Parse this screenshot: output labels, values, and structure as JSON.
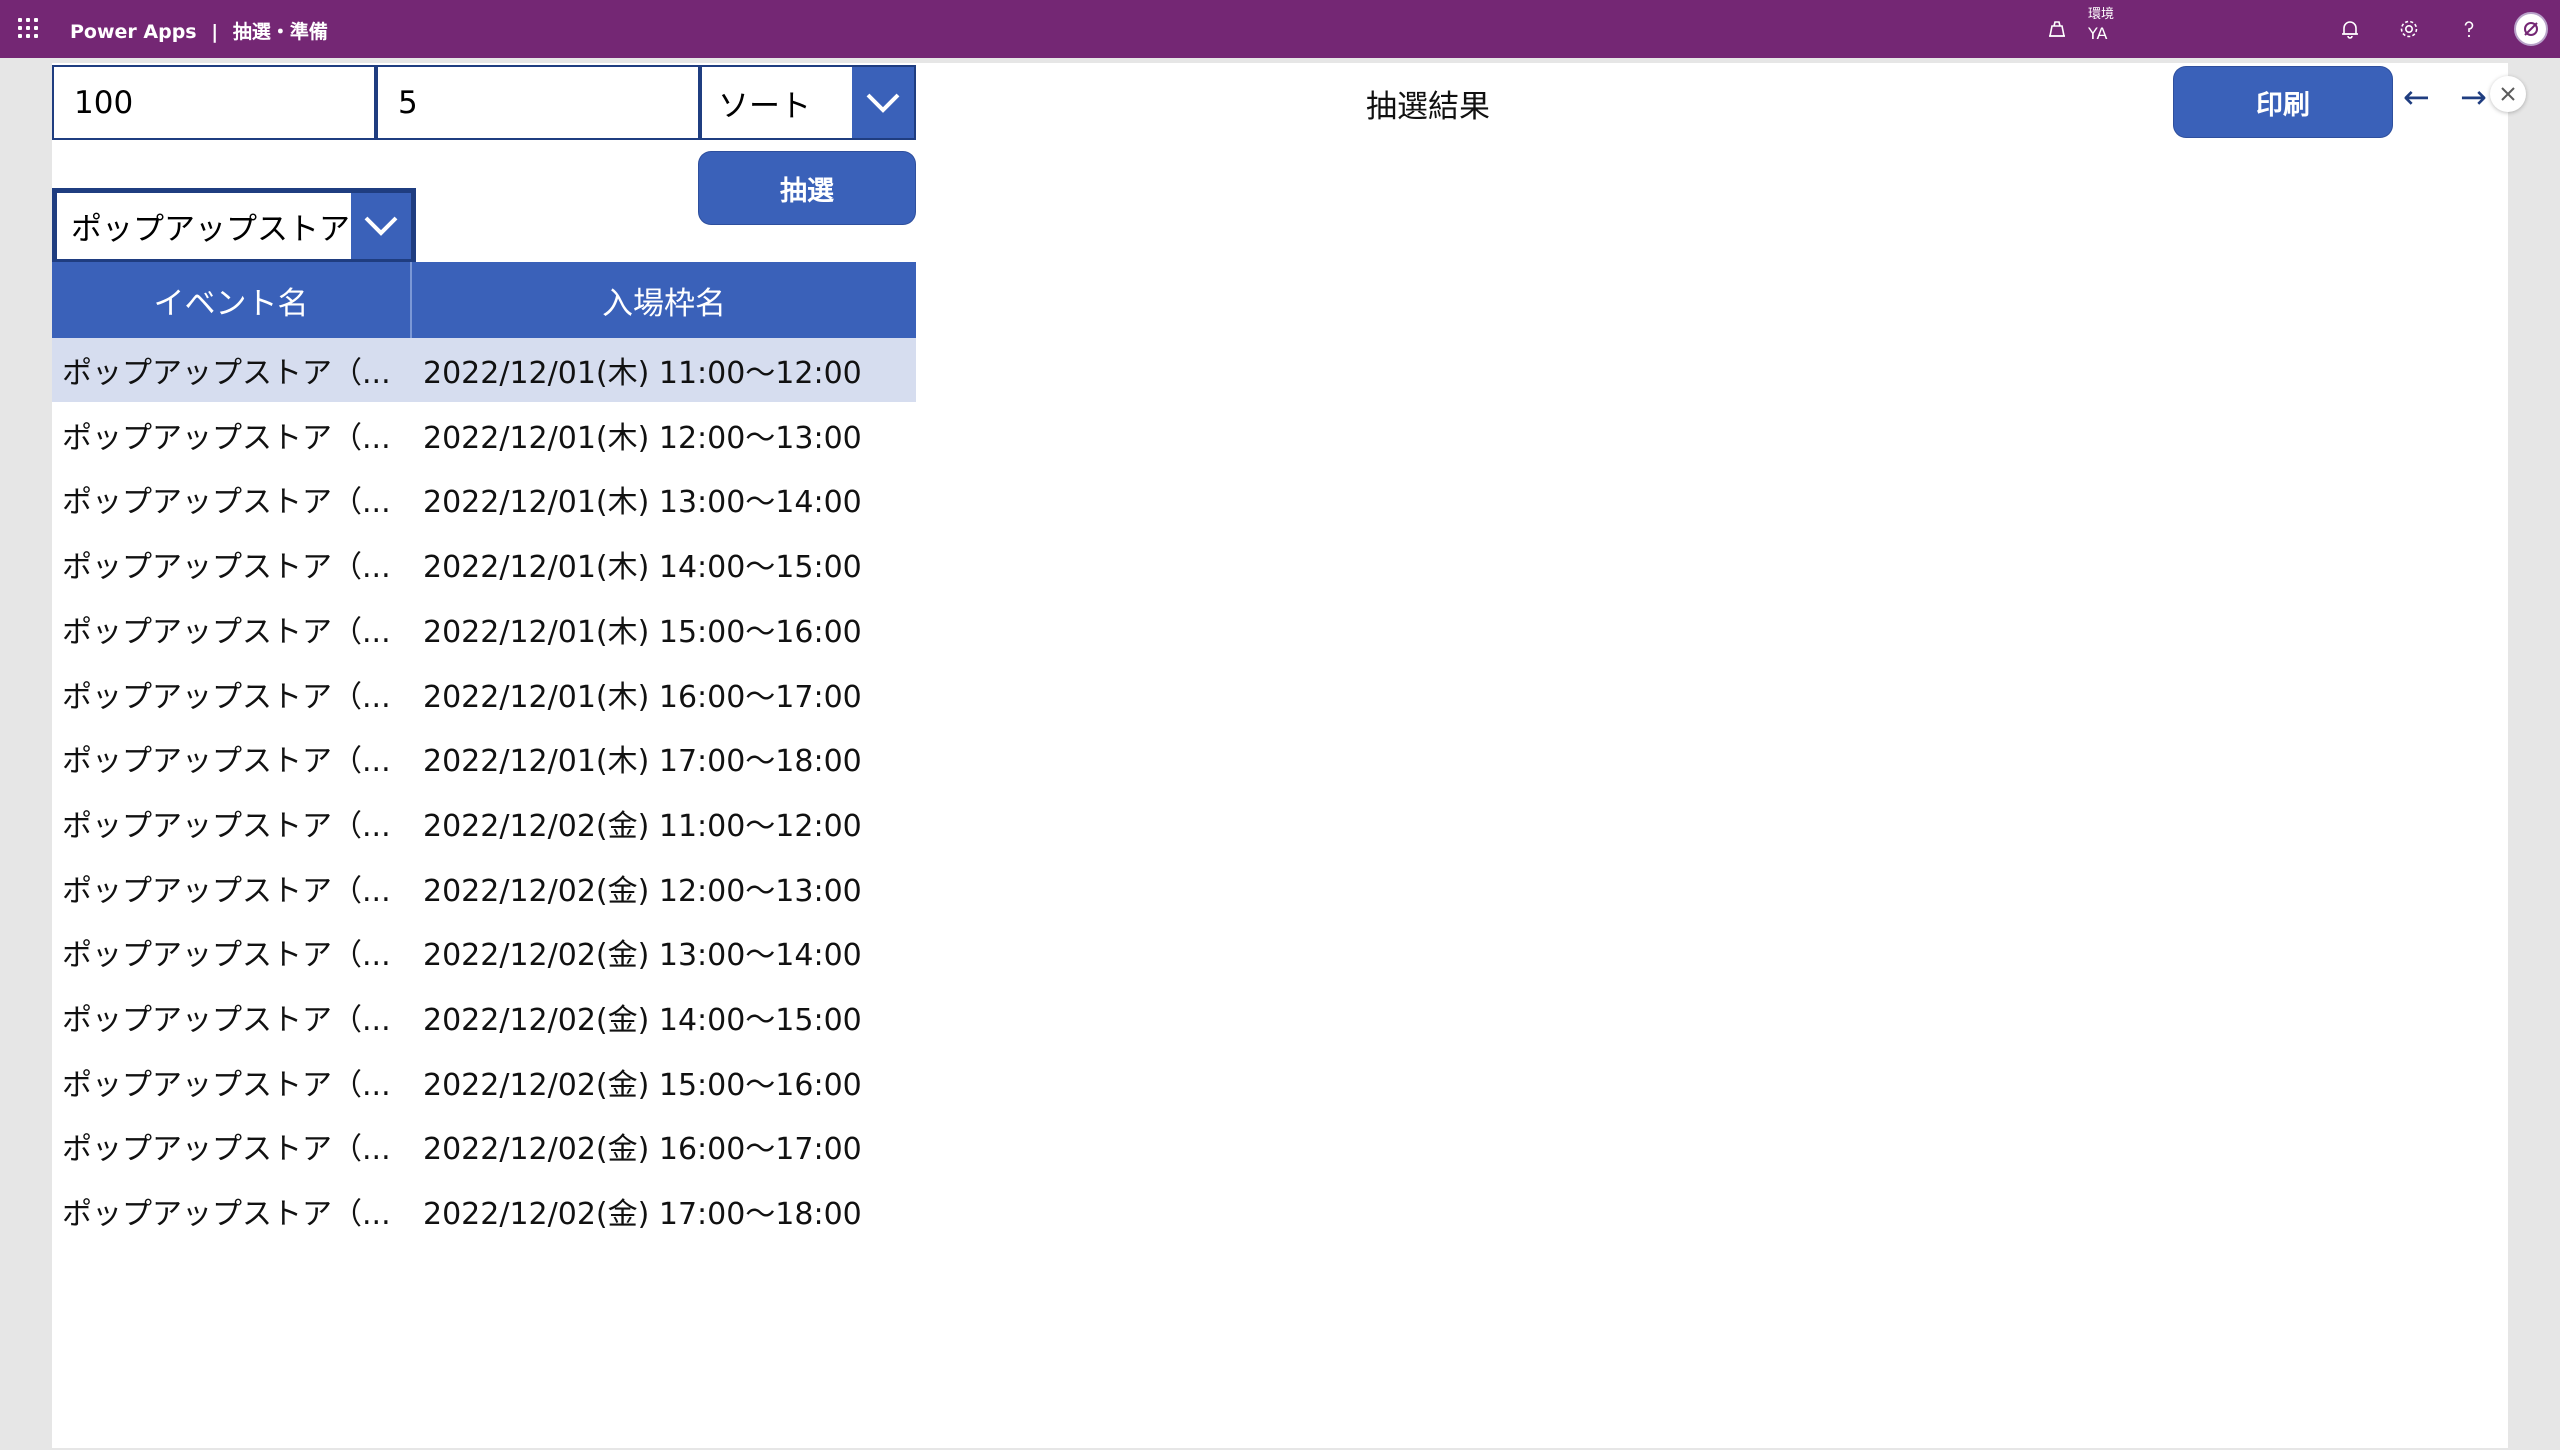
{
  "topbar": {
    "app_name": "Power Apps",
    "separator": "|",
    "app_title": "抽選・準備",
    "environment_label": "環境",
    "environment_value": "YA",
    "icons": [
      "waffle-icon",
      "environment-icon",
      "bell-icon",
      "gear-icon",
      "help-icon",
      "avatar-icon"
    ]
  },
  "controls": {
    "input1_value": "100",
    "input2_value": "5",
    "sort_dropdown_value": "ソート",
    "event_dropdown_value": "ポップアップストア（",
    "draw_button_label": "抽選",
    "print_button_label": "印刷",
    "result_title": "抽選結果",
    "back_arrow": "←",
    "forward_arrow": "→",
    "close_glyph": "×"
  },
  "table": {
    "headers": [
      "イベント名",
      "入場枠名"
    ],
    "selected_row": 0,
    "rows": [
      {
        "event": "ポップアップストア（...",
        "slot": "2022/12/01(木) 11:00～12:00"
      },
      {
        "event": "ポップアップストア（...",
        "slot": "2022/12/01(木) 12:00～13:00"
      },
      {
        "event": "ポップアップストア（...",
        "slot": "2022/12/01(木) 13:00～14:00"
      },
      {
        "event": "ポップアップストア（...",
        "slot": "2022/12/01(木) 14:00～15:00"
      },
      {
        "event": "ポップアップストア（...",
        "slot": "2022/12/01(木) 15:00～16:00"
      },
      {
        "event": "ポップアップストア（...",
        "slot": "2022/12/01(木) 16:00～17:00"
      },
      {
        "event": "ポップアップストア（...",
        "slot": "2022/12/01(木) 17:00～18:00"
      },
      {
        "event": "ポップアップストア（...",
        "slot": "2022/12/02(金) 11:00～12:00"
      },
      {
        "event": "ポップアップストア（...",
        "slot": "2022/12/02(金) 12:00～13:00"
      },
      {
        "event": "ポップアップストア（...",
        "slot": "2022/12/02(金) 13:00～14:00"
      },
      {
        "event": "ポップアップストア（...",
        "slot": "2022/12/02(金) 14:00～15:00"
      },
      {
        "event": "ポップアップストア（...",
        "slot": "2022/12/02(金) 15:00～16:00"
      },
      {
        "event": "ポップアップストア（...",
        "slot": "2022/12/02(金) 16:00～17:00"
      },
      {
        "event": "ポップアップストア（...",
        "slot": "2022/12/02(金) 17:00～18:00"
      }
    ]
  },
  "colors": {
    "suite_bar": "#742774",
    "accent_blue": "#3a61b9",
    "border_navy": "#1f3d80",
    "selected_row": "#d6ddef"
  }
}
